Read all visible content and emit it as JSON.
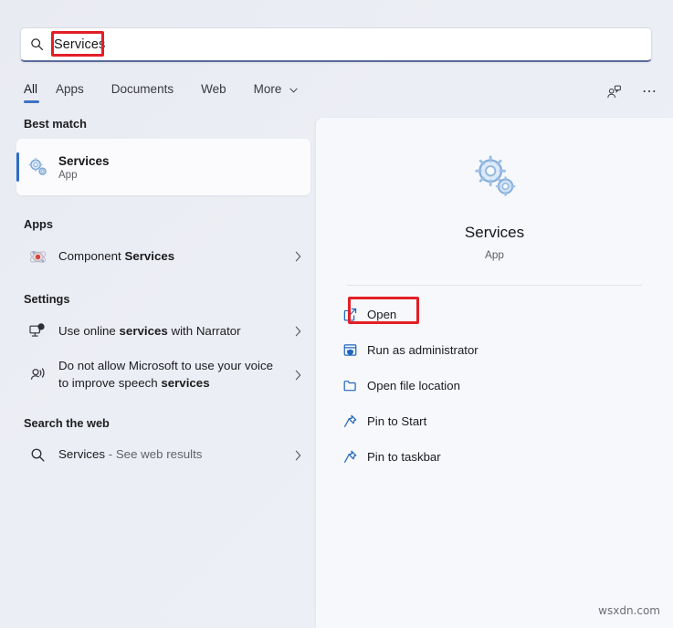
{
  "search": {
    "value": "Services",
    "icon": "search-icon",
    "highlight_color": "#e21f26"
  },
  "tabs": {
    "items": [
      {
        "label": "All",
        "active": true
      },
      {
        "label": "Apps",
        "active": false
      },
      {
        "label": "Documents",
        "active": false
      },
      {
        "label": "Web",
        "active": false
      },
      {
        "label": "More",
        "active": false,
        "chevron": "˅"
      }
    ],
    "accent_color": "#3f72c4",
    "feedback_icon": "feedback-person-icon",
    "more_options_icon": "ellipsis-icon"
  },
  "results": {
    "best_match": {
      "heading": "Best match",
      "title": "Services",
      "subtitle": "App",
      "icon": "services-gears-icon"
    },
    "apps": {
      "heading": "Apps",
      "items": [
        {
          "prefix": "Component ",
          "bold": "Services",
          "suffix": "",
          "icon": "component-services-icon",
          "chevron": "›"
        }
      ]
    },
    "settings": {
      "heading": "Settings",
      "items": [
        {
          "prefix": "Use online ",
          "bold": "services",
          "suffix": " with Narrator",
          "icon": "narrator-monitor-icon",
          "chevron": "›"
        },
        {
          "prefix": "Do not allow Microsoft to use your voice to improve speech ",
          "bold": "services",
          "suffix": "",
          "icon": "speech-voice-icon",
          "chevron": "›"
        }
      ]
    },
    "web": {
      "heading": "Search the web",
      "items": [
        {
          "prefix": "Services",
          "bold": "",
          "suffix": " - See web results",
          "icon": "search-icon",
          "chevron": "›"
        }
      ]
    }
  },
  "preview": {
    "icon": "services-gears-icon",
    "name": "Services",
    "type": "App",
    "actions": [
      {
        "label": "Open",
        "icon": "open-external-icon",
        "highlighted": true
      },
      {
        "label": "Run as administrator",
        "icon": "shield-window-icon",
        "highlighted": false
      },
      {
        "label": "Open file location",
        "icon": "folder-icon",
        "highlighted": false
      },
      {
        "label": "Pin to Start",
        "icon": "pin-icon",
        "highlighted": false
      },
      {
        "label": "Pin to taskbar",
        "icon": "pin-icon",
        "highlighted": false
      }
    ]
  },
  "watermark": {
    "text": "wsxdn.com"
  }
}
